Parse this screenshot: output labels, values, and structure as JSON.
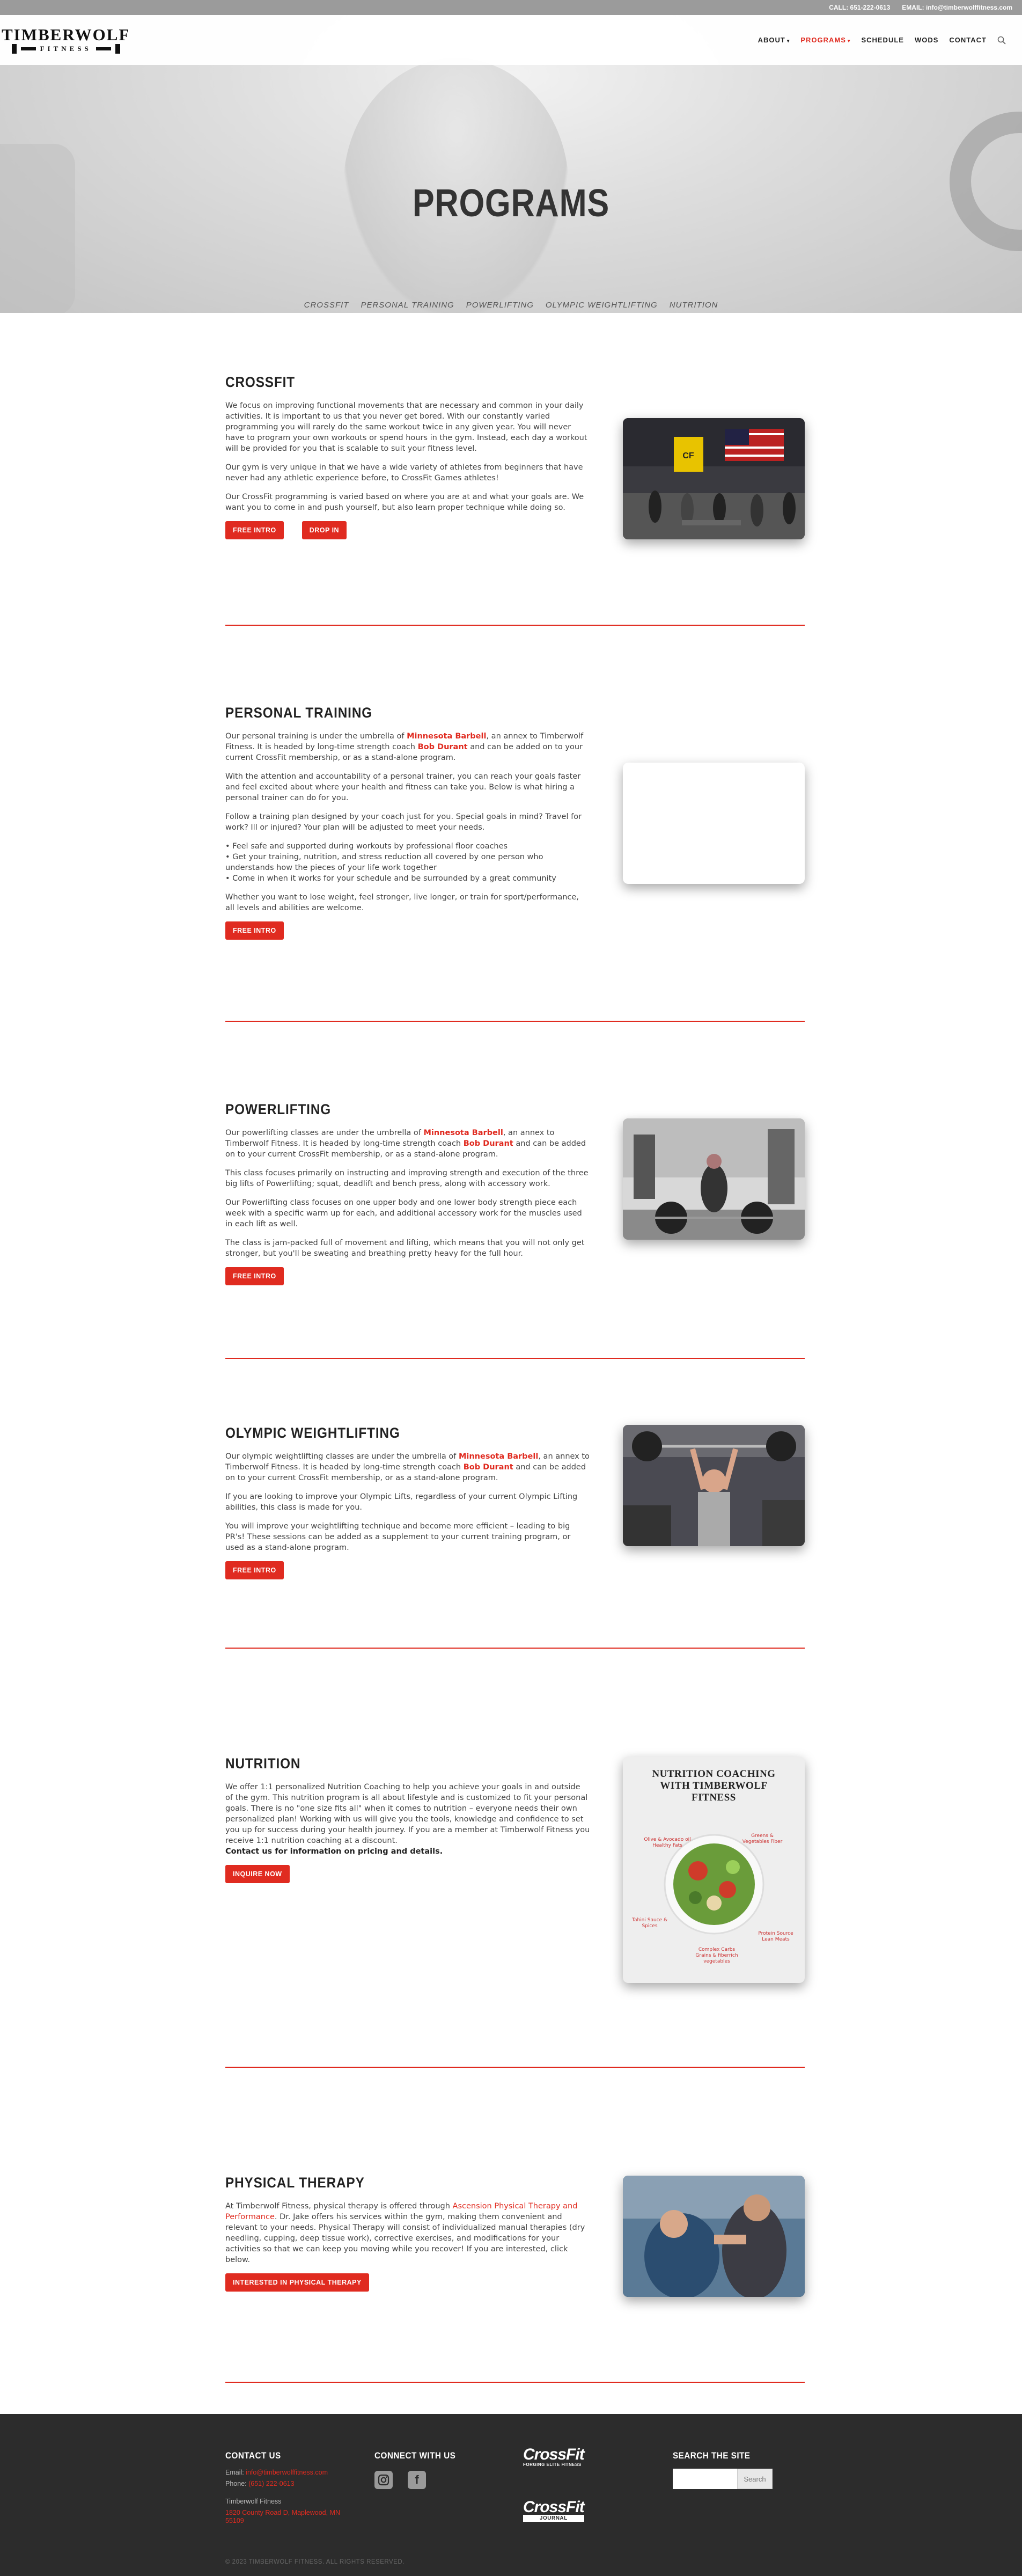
{
  "topbar": {
    "phone": "CALL: 651-222-0613",
    "email": "EMAIL: info@timberwolffitness.com"
  },
  "header": {
    "logo_main": "TIMBERWOLF",
    "logo_sub": "FITNESS",
    "nav": [
      {
        "label": "ABOUT",
        "dropdown": true,
        "active": false
      },
      {
        "label": "PROGRAMS",
        "dropdown": true,
        "active": true
      },
      {
        "label": "SCHEDULE",
        "dropdown": false,
        "active": false
      },
      {
        "label": "WODS",
        "dropdown": false,
        "active": false
      },
      {
        "label": "CONTACT",
        "dropdown": false,
        "active": false
      }
    ],
    "search_icon": "search-icon"
  },
  "hero": {
    "title": "PROGRAMS",
    "tabs": [
      "CROSSFIT",
      "PERSONAL TRAINING",
      "POWERLIFTING",
      "OLYMPIC WEIGHTLIFTING",
      "NUTRITION"
    ]
  },
  "crossfit": {
    "title": "CROSSFIT",
    "p1": "We focus on improving functional movements that are necessary and common in your daily activities. It is important to us that you never get bored. With our constantly varied programming you will rarely do the same workout twice in any given year. You will never have to program your own workouts or spend hours in the gym. Instead, each day a workout will be provided for you that is scalable to suit your fitness level.",
    "p2": "Our gym is very unique in that we have a wide variety of athletes from beginners that have never had any athletic experience before, to CrossFit Games athletes!",
    "p3": "Our CrossFit programming is varied based on where you are at and what your goals are. We want you to come in and push yourself, but also learn proper technique while doing so.",
    "btn1": "FREE INTRO",
    "btn2": "DROP IN"
  },
  "personal": {
    "title": "PERSONAL TRAINING",
    "p1a": "Our personal training is under the umbrella of ",
    "link1": "Minnesota Barbell",
    "p1b": ", an annex to Timberwolf Fitness. It is headed by long-time strength coach ",
    "link2": "Bob Durant",
    "p1c": " and can be added on to your current CrossFit membership, or as a stand-alone program.",
    "p2": "With the attention and accountability of a personal trainer, you can reach your goals faster and feel excited about where your health and fitness can take you. Below is what hiring a personal trainer can do for you.",
    "p3": "Follow a training plan designed by your coach just for you. Special goals in mind? Travel for work? Ill or injured? Your plan will be adjusted to meet your needs.",
    "bullets": [
      "• Feel safe and supported during workouts by professional floor coaches",
      "• Get your training, nutrition, and stress reduction all covered by one person who understands how the pieces of your life work together",
      "• Come in when it works for your schedule and be surrounded by a great community"
    ],
    "p4": "Whether you want to lose weight, feel stronger, live longer, or train for sport/performance, all levels and abilities are welcome.",
    "btn": "FREE INTRO"
  },
  "powerlifting": {
    "title": "POWERLIFTING",
    "p1a": "Our powerlifting classes are under the umbrella of ",
    "link1": "Minnesota Barbell",
    "p1b": ", an annex to Timberwolf Fitness. It is headed by long-time strength coach ",
    "link2": "Bob Durant",
    "p1c": " and can be added on to your current CrossFit membership, or as a stand-alone program.",
    "p2": "This class focuses primarily on instructing and improving strength and execution of the three big lifts of Powerlifting; squat, deadlift and bench press, along with accessory work.",
    "p3": "Our Powerlifting class focuses on one upper body and one lower body strength piece each week with a specific warm up for each, and additional accessory work for the muscles used in each lift as well.",
    "p4": "The class is jam-packed full of movement and lifting, which means that you will not only get stronger, but you'll be sweating and breathing pretty heavy for the full hour.",
    "btn": "FREE INTRO"
  },
  "olympic": {
    "title": "OLYMPIC WEIGHTLIFTING",
    "p1a": "Our olympic weightlifting classes are under the umbrella of ",
    "link1": "Minnesota Barbell",
    "p1b": ", an annex to Timberwolf Fitness. It is headed by long-time strength coach ",
    "link2": "Bob Durant",
    "p1c": " and can be added on to your current CrossFit membership, or as a stand-alone program.",
    "p2": "If you are looking to improve your Olympic Lifts, regardless of your current Olympic Lifting abilities, this class is made for you.",
    "p3": "You will improve your weightlifting technique and become more efficient – leading to big PR's! These sessions can be added as a supplement to your current training program, or used as a stand-alone program.",
    "btn": "FREE INTRO"
  },
  "nutrition": {
    "title": "NUTRITION",
    "p1": "We offer 1:1 personalized Nutrition Coaching to help you achieve your goals in and outside of the gym. This nutrition program is all about lifestyle and is customized to fit your personal goals. There is no \"one size fits all\" when it comes to nutrition – everyone needs their own personalized plan! Working with us will give you the tools, knowledge and confidence to set you up for success during your health journey. If you are a member at Timberwolf Fitness you receive 1:1 nutrition coaching at a discount.",
    "p1_strong": "Contact us for information on pricing and details.",
    "btn": "INQUIRE NOW",
    "card_title": "NUTRITION COACHING WITH TIMBERWOLF FITNESS",
    "card_labels": [
      "Olive & Avocado oil Healthy Fats",
      "Greens & Vegetables Fiber",
      "Tahini Sauce & Spices",
      "Protein Source Lean Meats",
      "Complex Carbs Grains & fiberrich vegetables"
    ]
  },
  "therapy": {
    "title": "PHYSICAL THERAPY",
    "p1a": "At Timberwolf Fitness, physical therapy is offered through ",
    "link1": "Ascension Physical Therapy and Performance",
    "p1b": ". Dr. Jake offers his services within the gym, making them convenient and relevant to your needs. Physical Therapy will consist of individualized manual therapies (dry needling, cupping, deep tissue work), corrective exercises, and modifications for your activities so that we can keep you moving while you recover! If you are interested, click below.",
    "btn": "INTERESTED IN PHYSICAL THERAPY"
  },
  "footer": {
    "contact_h": "CONTACT US",
    "email_label": "Email: ",
    "email": "info@timberwolffitness.com",
    "phone_label": "Phone: ",
    "phone": "(651) 222-0613",
    "name": "Timberwolf Fitness",
    "addr1": "1820 County Road D, Maplewood, MN",
    "addr2": "55109",
    "connect_h": "CONNECT WITH US",
    "cf1_main": "CrossFit",
    "cf1_sub": "FORGING ELITE FITNESS",
    "cf2_main": "CrossFit",
    "cf2_sub": "JOURNAL",
    "search_h": "SEARCH THE SITE",
    "search_btn": "Search",
    "copyright": "© 2023 TIMBERWOLF FITNESS. ALL RIGHTS RESERVED."
  }
}
